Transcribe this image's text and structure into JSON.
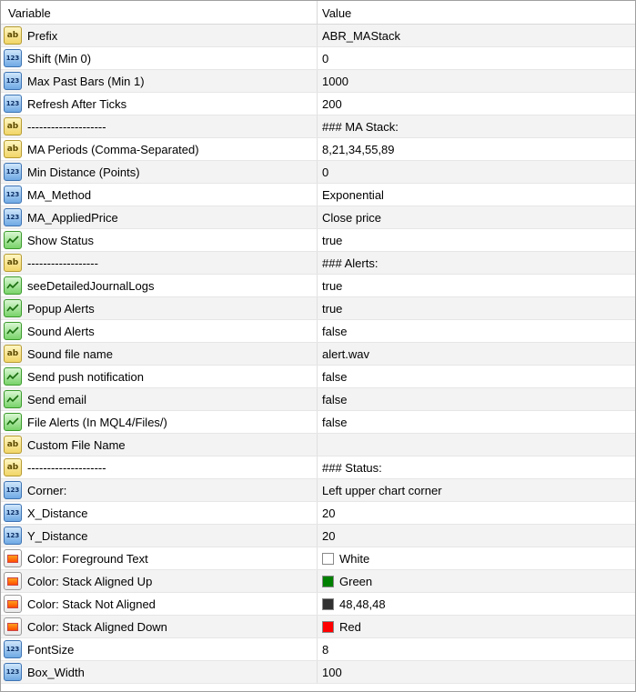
{
  "header": {
    "variable": "Variable",
    "value": "Value"
  },
  "rows": [
    {
      "type": "ab",
      "name": "Prefix",
      "value": "ABR_MAStack"
    },
    {
      "type": "num",
      "name": "Shift (Min 0)",
      "value": "0"
    },
    {
      "type": "num",
      "name": "Max Past Bars (Min 1)",
      "value": "1000"
    },
    {
      "type": "num",
      "name": "Refresh After Ticks",
      "value": "200"
    },
    {
      "type": "ab",
      "name": "--------------------",
      "value": "### MA Stack:"
    },
    {
      "type": "ab",
      "name": "MA Periods (Comma-Separated)",
      "value": "8,21,34,55,89"
    },
    {
      "type": "num",
      "name": "Min Distance (Points)",
      "value": "0"
    },
    {
      "type": "num",
      "name": "MA_Method",
      "value": "Exponential"
    },
    {
      "type": "num",
      "name": "MA_AppliedPrice",
      "value": "Close price"
    },
    {
      "type": "bool",
      "name": "Show Status",
      "value": "true"
    },
    {
      "type": "ab",
      "name": "------------------",
      "value": "### Alerts:"
    },
    {
      "type": "bool",
      "name": "seeDetailedJournalLogs",
      "value": "true"
    },
    {
      "type": "bool",
      "name": "Popup Alerts",
      "value": "true"
    },
    {
      "type": "bool",
      "name": "Sound Alerts",
      "value": "false"
    },
    {
      "type": "ab",
      "name": "Sound file name",
      "value": "alert.wav"
    },
    {
      "type": "bool",
      "name": "Send push notification",
      "value": "false"
    },
    {
      "type": "bool",
      "name": "Send email",
      "value": "false"
    },
    {
      "type": "bool",
      "name": "File Alerts (In MQL4/Files/)",
      "value": "false"
    },
    {
      "type": "ab",
      "name": "Custom File Name",
      "value": ""
    },
    {
      "type": "ab",
      "name": "--------------------",
      "value": "### Status:"
    },
    {
      "type": "num",
      "name": "Corner:",
      "value": "Left upper chart corner"
    },
    {
      "type": "num",
      "name": "X_Distance",
      "value": "20"
    },
    {
      "type": "num",
      "name": "Y_Distance",
      "value": "20"
    },
    {
      "type": "color",
      "name": "Color: Foreground Text",
      "value": "White",
      "swatch": "#ffffff"
    },
    {
      "type": "color",
      "name": "Color: Stack Aligned Up",
      "value": "Green",
      "swatch": "#008000"
    },
    {
      "type": "color",
      "name": "Color: Stack Not Aligned",
      "value": "48,48,48",
      "swatch": "#303030"
    },
    {
      "type": "color",
      "name": "Color: Stack Aligned Down",
      "value": "Red",
      "swatch": "#ff0000"
    },
    {
      "type": "num",
      "name": "FontSize",
      "value": "8"
    },
    {
      "type": "num",
      "name": "Box_Width",
      "value": "100"
    }
  ],
  "icons": {
    "ab": "string-type-icon",
    "num": "integer-type-icon",
    "bool": "boolean-type-icon",
    "color": "color-type-icon"
  },
  "icon_labels": {
    "ab": "ab",
    "num": "123"
  }
}
